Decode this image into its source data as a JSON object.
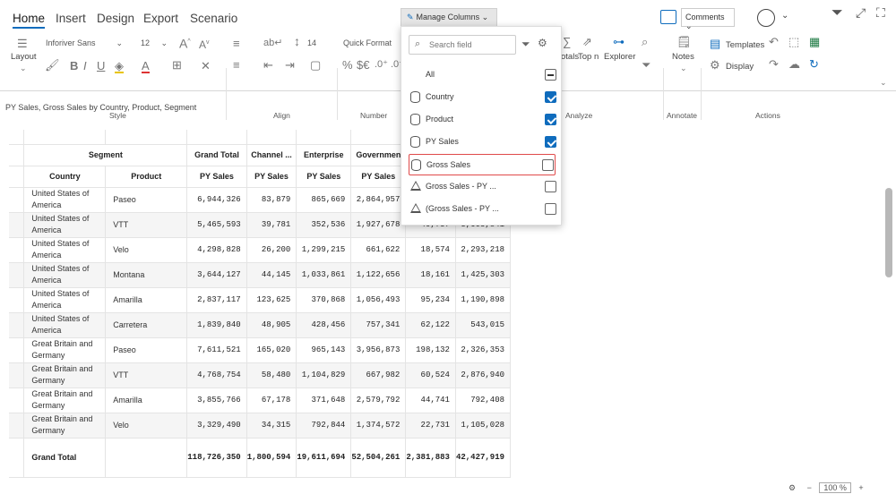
{
  "menu": {
    "home": "Home",
    "insert": "Insert",
    "design": "Design",
    "export": "Export",
    "scenario": "Scenario"
  },
  "toolbar": {
    "layout": "Layout",
    "font_name": "Inforiver Sans",
    "font_size": "12",
    "row_height": "14",
    "number_format": "Quick Format",
    "manage_columns": "Manage Columns",
    "comments": "Comments",
    "templates": "Templates",
    "display": "Display",
    "notes": "Notes",
    "totals": "otals",
    "topn": "Top n",
    "explorer": "Explorer",
    "currency": "$€",
    "percent": "%",
    "dec_up": ".0⁺",
    "dec_down": ".0⁻"
  },
  "groups": {
    "style": "Style",
    "align": "Align",
    "number": "Number",
    "analyze": "Analyze",
    "annotate": "Annotate",
    "actions": "Actions"
  },
  "subtitle": "PY Sales, Gross Sales by Country, Product, Segment",
  "table": {
    "segment": "Segment",
    "country": "Country",
    "product": "Product",
    "col_groups": [
      "Grand Total",
      "Channel ...",
      "Enterprise",
      "Governmen"
    ],
    "measure": "PY Sales",
    "rows": [
      {
        "country": "United States of America",
        "product": "Paseo",
        "v": [
          "6,944,326",
          "83,879",
          "865,669",
          "2,864,957",
          "",
          ""
        ]
      },
      {
        "country": "United States of America",
        "product": "VTT",
        "v": [
          "5,465,593",
          "39,781",
          "352,536",
          "1,927,678",
          "49,757",
          "3,095,841"
        ]
      },
      {
        "country": "United States of America",
        "product": "Velo",
        "v": [
          "4,298,828",
          "26,200",
          "1,299,215",
          "661,622",
          "18,574",
          "2,293,218"
        ]
      },
      {
        "country": "United States of America",
        "product": "Montana",
        "v": [
          "3,644,127",
          "44,145",
          "1,033,861",
          "1,122,656",
          "18,161",
          "1,425,303"
        ]
      },
      {
        "country": "United States of America",
        "product": "Amarilla",
        "v": [
          "2,837,117",
          "123,625",
          "370,868",
          "1,056,493",
          "95,234",
          "1,190,898"
        ]
      },
      {
        "country": "United States of America",
        "product": "Carretera",
        "v": [
          "1,839,840",
          "48,905",
          "428,456",
          "757,341",
          "62,122",
          "543,015"
        ]
      },
      {
        "country": "Great Britain and Germany",
        "product": "Paseo",
        "v": [
          "7,611,521",
          "165,020",
          "965,143",
          "3,956,873",
          "198,132",
          "2,326,353"
        ]
      },
      {
        "country": "Great Britain and Germany",
        "product": "VTT",
        "v": [
          "4,768,754",
          "58,480",
          "1,104,829",
          "667,982",
          "60,524",
          "2,876,940"
        ]
      },
      {
        "country": "Great Britain and Germany",
        "product": "Amarilla",
        "v": [
          "3,855,766",
          "67,178",
          "371,648",
          "2,579,792",
          "44,741",
          "792,408"
        ]
      },
      {
        "country": "Great Britain and Germany",
        "product": "Velo",
        "v": [
          "3,329,490",
          "34,315",
          "792,844",
          "1,374,572",
          "22,731",
          "1,105,028"
        ]
      }
    ],
    "grand_total_label": "Grand Total",
    "grand_total": [
      "118,726,350",
      "1,800,594",
      "19,611,694",
      "52,504,261",
      "2,381,883",
      "42,427,919"
    ]
  },
  "dropdown": {
    "search_placeholder": "Search field",
    "items": [
      {
        "label": "All",
        "kind": "none",
        "state": "mixed"
      },
      {
        "label": "Country",
        "kind": "cylinder",
        "state": "on"
      },
      {
        "label": "Product",
        "kind": "cylinder",
        "state": "on"
      },
      {
        "label": "PY Sales",
        "kind": "cylinder",
        "state": "on"
      },
      {
        "label": "Gross Sales",
        "kind": "cylinder",
        "state": "off"
      },
      {
        "label": "Gross Sales - PY ...",
        "kind": "triangle",
        "state": "off"
      },
      {
        "label": "(Gross Sales - PY ...",
        "kind": "triangle",
        "state": "off"
      }
    ]
  },
  "zoom": "100 %",
  "colors": {
    "accent": "#0f6cbd",
    "highlight": "#e04a4a"
  }
}
